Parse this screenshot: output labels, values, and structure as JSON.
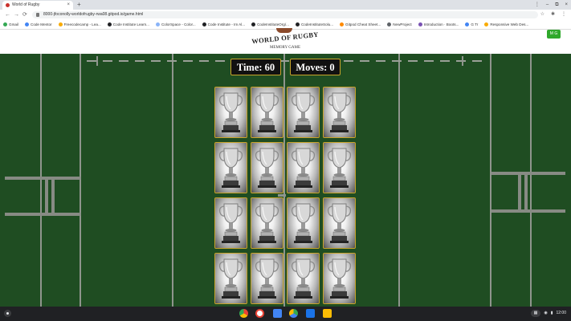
{
  "browser": {
    "tab_title": "World of Rugby",
    "new_tab": "+",
    "tab_close": "×",
    "window_controls": [
      "⋮",
      "–",
      "⧉",
      "×"
    ],
    "nav": {
      "back": "←",
      "forward": "→",
      "reload": "⟳"
    },
    "url": "8000-jfoconolly-worldofrugby-rwa08.gitpod.io/game.html",
    "addr_right": [
      "☆",
      "✱",
      "⋮"
    ],
    "bookmarks": [
      {
        "label": "Gmail",
        "color": "#34a853"
      },
      {
        "label": "Code Mentor",
        "color": "#4285f4"
      },
      {
        "label": "Freecodecamp - Lea...",
        "color": "#f9ab00"
      },
      {
        "label": "Code Institute Learn...",
        "color": "#202124"
      },
      {
        "label": "ColorSpace - Color...",
        "color": "#8ab4f8"
      },
      {
        "label": "Code Institute - Im Al...",
        "color": "#202124"
      },
      {
        "label": "CodeInstituteOrg/...",
        "color": "#202124"
      },
      {
        "label": "CodeInstituteSolu...",
        "color": "#202124"
      },
      {
        "label": "Gitpod Cheat Sheet...",
        "color": "#ff8a00"
      },
      {
        "label": "NewProject",
        "color": "#5f6368"
      },
      {
        "label": "Introduction · Boots...",
        "color": "#7952b3"
      },
      {
        "label": "G Tr",
        "color": "#4285f4"
      },
      {
        "label": "Responsive Web Des...",
        "color": "#f9ab00"
      }
    ]
  },
  "header": {
    "logo_title": "WORLD OF RUGBY",
    "logo_subtitle": "MEMORY GAME",
    "corner_button": "M G"
  },
  "stats": {
    "time_label": "Time: 60",
    "moves_label": "Moves: 0"
  },
  "cards": {
    "count": 16,
    "face": "trophy-icon"
  },
  "colors": {
    "field": "#1f4d22",
    "card_border": "#c9a42a",
    "stat_bg": "#111111"
  },
  "shelf": {
    "tray_time": "12:00",
    "apps": [
      "chrome",
      "gmail",
      "docs",
      "play-store",
      "files",
      "settings"
    ]
  }
}
